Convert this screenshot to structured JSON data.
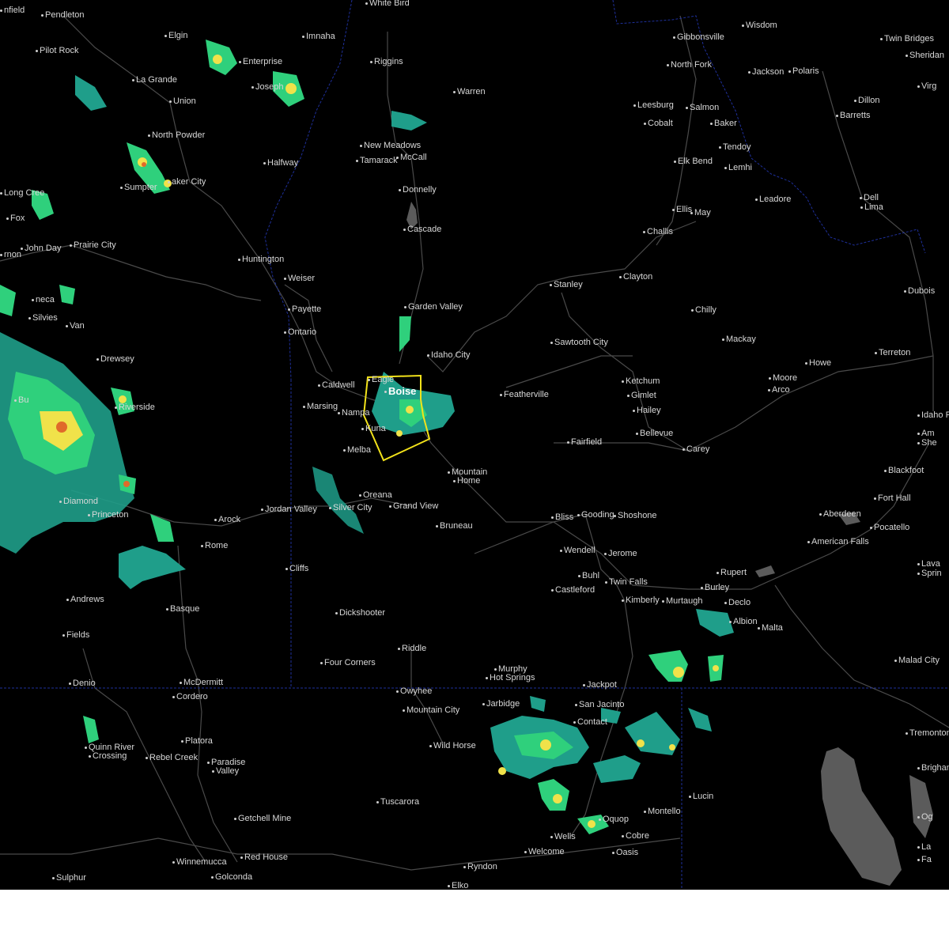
{
  "map": {
    "colors": {
      "background": "#000000",
      "roads": "#4a4a4a",
      "state_border": "#1e2f9a",
      "label": "#d8d8d8",
      "warning_polygon": "#f2e21a",
      "lake": "#5b5b5b",
      "radar_light": "#1f9e8a",
      "radar_mid": "#2fd07c",
      "radar_high": "#f0e24a",
      "radar_heavy": "#e06a2a"
    },
    "cities": [
      {
        "name": "nfield"
      },
      {
        "name": "Pendleton"
      },
      {
        "name": "Elgin"
      },
      {
        "name": "Imnaha"
      },
      {
        "name": "White Bird"
      },
      {
        "name": "Gibbonsville"
      },
      {
        "name": "Wisdom"
      },
      {
        "name": "Twin Bridges"
      },
      {
        "name": "Sheridan"
      },
      {
        "name": "Pilot Rock"
      },
      {
        "name": "Enterprise"
      },
      {
        "name": "Joseph"
      },
      {
        "name": "Riggins"
      },
      {
        "name": "North Fork"
      },
      {
        "name": "Jackson"
      },
      {
        "name": "Polaris"
      },
      {
        "name": "La Grande"
      },
      {
        "name": "Union"
      },
      {
        "name": "Warren"
      },
      {
        "name": "Leesburg"
      },
      {
        "name": "Salmon"
      },
      {
        "name": "Dillon"
      },
      {
        "name": "Barretts"
      },
      {
        "name": "Virg"
      },
      {
        "name": "Cobalt"
      },
      {
        "name": "Baker"
      },
      {
        "name": "North Powder"
      },
      {
        "name": "New Meadows"
      },
      {
        "name": "Tendoy"
      },
      {
        "name": "Tamarack"
      },
      {
        "name": "McCall"
      },
      {
        "name": "Halfway"
      },
      {
        "name": "Elk Bend"
      },
      {
        "name": "Lemhi"
      },
      {
        "name": "Sumpter"
      },
      {
        "name": "aker City"
      },
      {
        "name": "Donnelly"
      },
      {
        "name": "Long Cree"
      },
      {
        "name": "Leadore"
      },
      {
        "name": "Dell"
      },
      {
        "name": "Lima"
      },
      {
        "name": "Ellis"
      },
      {
        "name": "May"
      },
      {
        "name": "Fox"
      },
      {
        "name": "Cascade"
      },
      {
        "name": "Challis"
      },
      {
        "name": "Prairie City"
      },
      {
        "name": "John Day"
      },
      {
        "name": "rnon"
      },
      {
        "name": "Huntington"
      },
      {
        "name": "Clayton"
      },
      {
        "name": "Stanley"
      },
      {
        "name": "Weiser"
      },
      {
        "name": "Dubois"
      },
      {
        "name": "neca"
      },
      {
        "name": "Payette"
      },
      {
        "name": "Garden Valley"
      },
      {
        "name": "Chilly"
      },
      {
        "name": "Silvies"
      },
      {
        "name": "Van"
      },
      {
        "name": "Ontario"
      },
      {
        "name": "Mackay"
      },
      {
        "name": "Sawtooth City"
      },
      {
        "name": "Idaho City"
      },
      {
        "name": "Howe"
      },
      {
        "name": "Terreton"
      },
      {
        "name": "Drewsey"
      },
      {
        "name": "Eagle"
      },
      {
        "name": "Ketchum"
      },
      {
        "name": "Moore"
      },
      {
        "name": "Arco"
      },
      {
        "name": "Caldwell"
      },
      {
        "name": "Boise"
      },
      {
        "name": "Featherville"
      },
      {
        "name": "Gimlet"
      },
      {
        "name": "Idaho F"
      },
      {
        "name": "Bu"
      },
      {
        "name": "Riverside"
      },
      {
        "name": "Marsing"
      },
      {
        "name": "Nampa"
      },
      {
        "name": "Hailey"
      },
      {
        "name": "Kuna"
      },
      {
        "name": "Bellevue"
      },
      {
        "name": "Am"
      },
      {
        "name": "She"
      },
      {
        "name": "Fairfield"
      },
      {
        "name": "Melba"
      },
      {
        "name": "Carey"
      },
      {
        "name": "Mountain"
      },
      {
        "name": "Home"
      },
      {
        "name": "Blackfoot"
      },
      {
        "name": "Oreana"
      },
      {
        "name": "Fort Hall"
      },
      {
        "name": "Diamond"
      },
      {
        "name": "Silver City"
      },
      {
        "name": "Grand View"
      },
      {
        "name": "Jordan Valley"
      },
      {
        "name": "Princeton"
      },
      {
        "name": "Aberdeen"
      },
      {
        "name": "Arock"
      },
      {
        "name": "Bliss"
      },
      {
        "name": "Gooding"
      },
      {
        "name": "Shoshone"
      },
      {
        "name": "Pocatello"
      },
      {
        "name": "Bruneau"
      },
      {
        "name": "Rome"
      },
      {
        "name": "American Falls"
      },
      {
        "name": "Wendell"
      },
      {
        "name": "Jerome"
      },
      {
        "name": "Lava"
      },
      {
        "name": "Sprin"
      },
      {
        "name": "Cliffs"
      },
      {
        "name": "Rupert"
      },
      {
        "name": "Buhl"
      },
      {
        "name": "Twin Falls"
      },
      {
        "name": "Castleford"
      },
      {
        "name": "Burley"
      },
      {
        "name": "Andrews"
      },
      {
        "name": "Kimberly"
      },
      {
        "name": "Murtaugh"
      },
      {
        "name": "Declo"
      },
      {
        "name": "Basque"
      },
      {
        "name": "Dickshooter"
      },
      {
        "name": "Albion"
      },
      {
        "name": "Malta"
      },
      {
        "name": "Fields"
      },
      {
        "name": "Riddle"
      },
      {
        "name": "Four Corners"
      },
      {
        "name": "Malad City"
      },
      {
        "name": "Murphy"
      },
      {
        "name": "Hot Springs"
      },
      {
        "name": "Denio"
      },
      {
        "name": "McDermitt"
      },
      {
        "name": "Jackpot"
      },
      {
        "name": "Owyhee"
      },
      {
        "name": "Cordero"
      },
      {
        "name": "Jarbidge"
      },
      {
        "name": "San Jacinto"
      },
      {
        "name": "Mountain City"
      },
      {
        "name": "Contact"
      },
      {
        "name": "Tremonton"
      },
      {
        "name": "Platora"
      },
      {
        "name": "Wild Horse"
      },
      {
        "name": "Quinn River"
      },
      {
        "name": "Crossing"
      },
      {
        "name": "Brigham"
      },
      {
        "name": "Rebel Creek"
      },
      {
        "name": "Paradise"
      },
      {
        "name": "Valley"
      },
      {
        "name": "Lucin"
      },
      {
        "name": "Tuscarora"
      },
      {
        "name": "Montello"
      },
      {
        "name": "Oquop"
      },
      {
        "name": "Getchell Mine"
      },
      {
        "name": "Wells"
      },
      {
        "name": "Cobre"
      },
      {
        "name": "Welcome"
      },
      {
        "name": "Oasis"
      },
      {
        "name": "Og"
      },
      {
        "name": "La"
      },
      {
        "name": "Fa"
      },
      {
        "name": "Winnemucca"
      },
      {
        "name": "Red House"
      },
      {
        "name": "Golconda"
      },
      {
        "name": "Ryndon"
      },
      {
        "name": "Sulphur"
      },
      {
        "name": "Elko"
      }
    ]
  }
}
